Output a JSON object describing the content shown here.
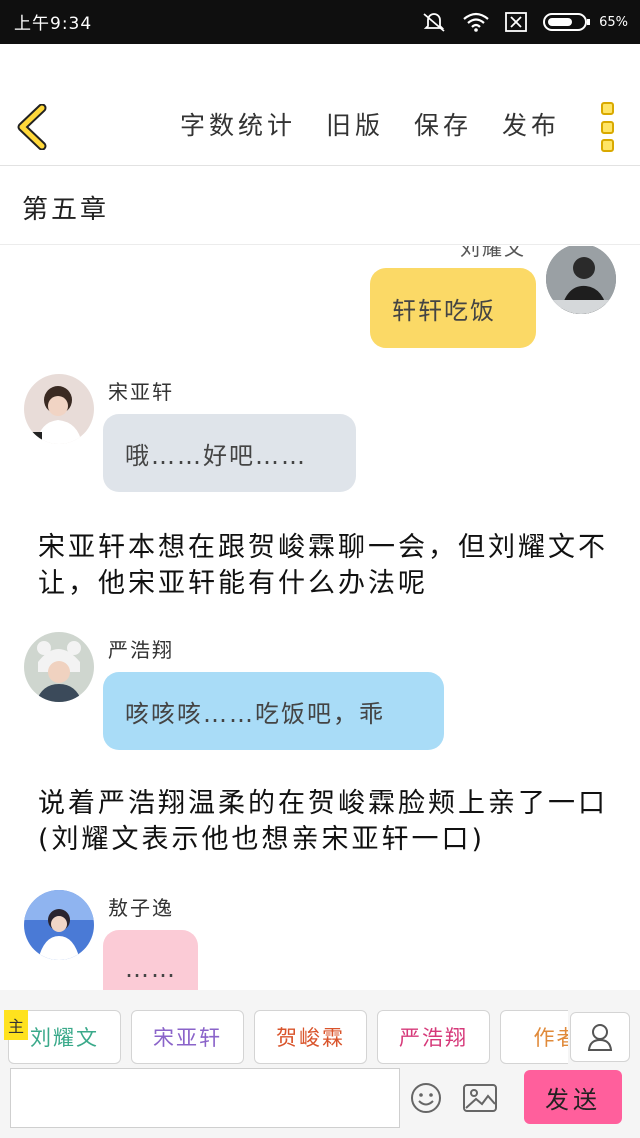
{
  "status_bar": {
    "time": "上午9:34",
    "battery": "65%"
  },
  "toolbar": {
    "actions": [
      "字数统计",
      "旧版",
      "保存",
      "发布"
    ]
  },
  "chapter": {
    "title": "第五章"
  },
  "messages": [
    {
      "kind": "outgoing",
      "sender": "刘耀文",
      "text": "轩轩吃饭",
      "bubble_color": "#fbd966"
    },
    {
      "kind": "incoming",
      "sender": "宋亚轩",
      "text": "哦……好吧……",
      "bubble_color": "#dfe4ea"
    },
    {
      "kind": "narration",
      "text": "宋亚轩本想在跟贺峻霖聊一会，但刘耀文不让，他宋亚轩能有什么办法呢"
    },
    {
      "kind": "incoming",
      "sender": "严浩翔",
      "text": "咳咳咳……吃饭吧，乖",
      "bubble_color": "#a9dcf7"
    },
    {
      "kind": "narration",
      "text": "说着严浩翔温柔的在贺峻霖脸颊上亲了一口(刘耀文表示他也想亲宋亚轩一口)"
    },
    {
      "kind": "incoming",
      "sender": "敖子逸",
      "text": "……",
      "bubble_color": "#fbcbd6"
    }
  ],
  "role_bar": {
    "main_tag": "主",
    "roles": [
      {
        "name": "刘耀文",
        "color": "#3aa98a"
      },
      {
        "name": "宋亚轩",
        "color": "#8a63c9"
      },
      {
        "name": "贺峻霖",
        "color": "#d9542b"
      },
      {
        "name": "严浩翔",
        "color": "#d63a7a"
      },
      {
        "name": "作者",
        "color": "#e08a3a"
      }
    ]
  },
  "composer": {
    "input_value": "",
    "send_label": "发送"
  }
}
